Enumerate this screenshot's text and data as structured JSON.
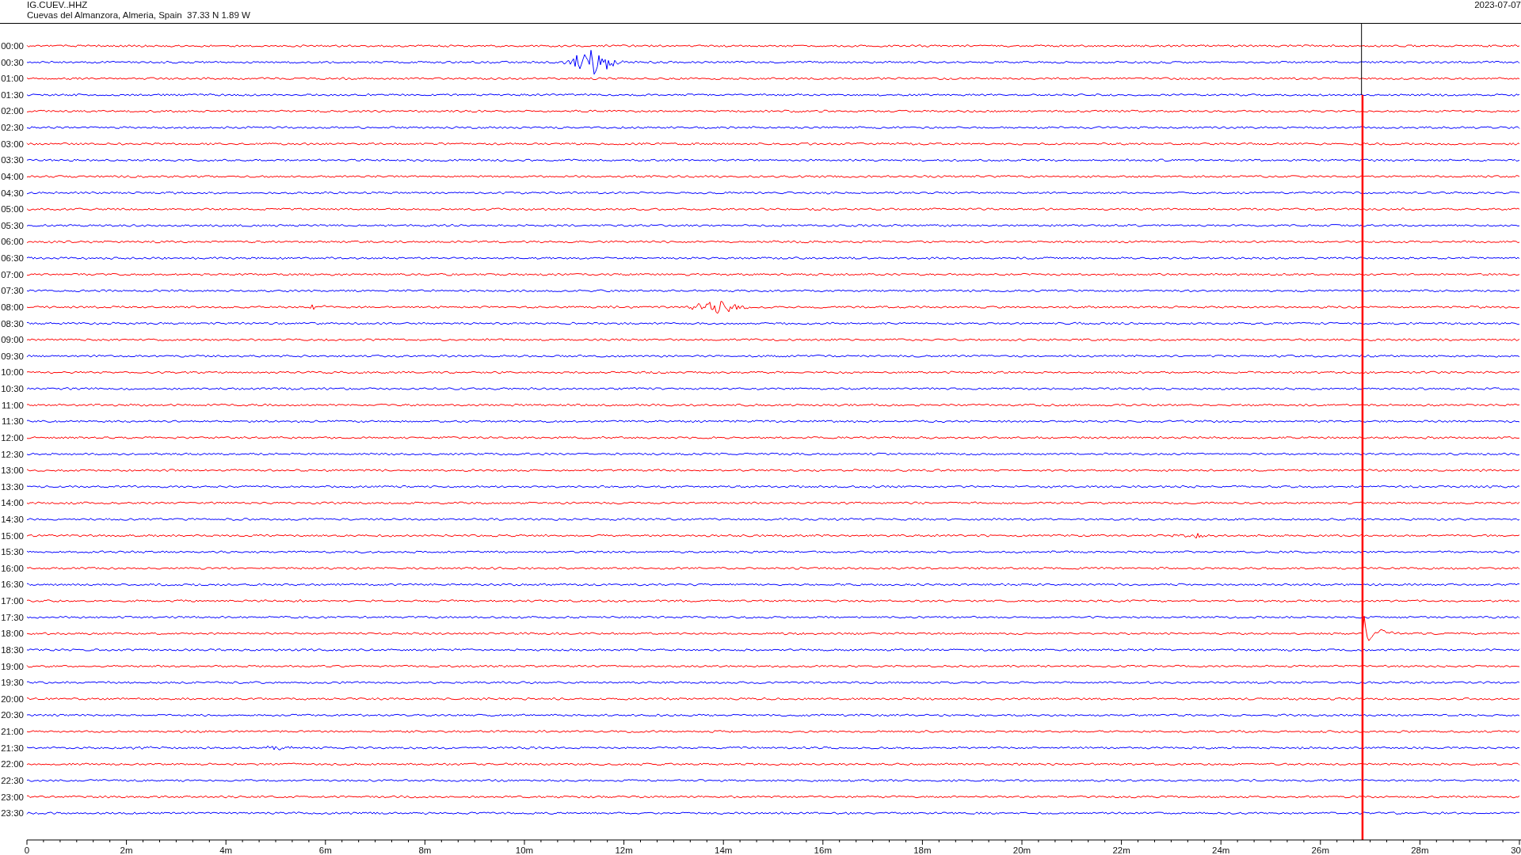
{
  "header": {
    "station": "IG.CUEV..HHZ",
    "location": "Cuevas del Almanzora, Almeria, Spain  37.33 N 1.89 W",
    "date": "2023-07-07"
  },
  "rows": [
    {
      "label": "00:00",
      "color": "#ff0000"
    },
    {
      "label": "00:30",
      "color": "#0000ff"
    },
    {
      "label": "01:00",
      "color": "#ff0000"
    },
    {
      "label": "01:30",
      "color": "#0000ff"
    },
    {
      "label": "02:00",
      "color": "#ff0000"
    },
    {
      "label": "02:30",
      "color": "#0000ff"
    },
    {
      "label": "03:00",
      "color": "#ff0000"
    },
    {
      "label": "03:30",
      "color": "#0000ff"
    },
    {
      "label": "04:00",
      "color": "#ff0000"
    },
    {
      "label": "04:30",
      "color": "#0000ff"
    },
    {
      "label": "05:00",
      "color": "#ff0000"
    },
    {
      "label": "05:30",
      "color": "#0000ff"
    },
    {
      "label": "06:00",
      "color": "#ff0000"
    },
    {
      "label": "06:30",
      "color": "#0000ff"
    },
    {
      "label": "07:00",
      "color": "#ff0000"
    },
    {
      "label": "07:30",
      "color": "#0000ff"
    },
    {
      "label": "08:00",
      "color": "#ff0000"
    },
    {
      "label": "08:30",
      "color": "#0000ff"
    },
    {
      "label": "09:00",
      "color": "#ff0000"
    },
    {
      "label": "09:30",
      "color": "#0000ff"
    },
    {
      "label": "10:00",
      "color": "#ff0000"
    },
    {
      "label": "10:30",
      "color": "#0000ff"
    },
    {
      "label": "11:00",
      "color": "#ff0000"
    },
    {
      "label": "11:30",
      "color": "#0000ff"
    },
    {
      "label": "12:00",
      "color": "#ff0000"
    },
    {
      "label": "12:30",
      "color": "#0000ff"
    },
    {
      "label": "13:00",
      "color": "#ff0000"
    },
    {
      "label": "13:30",
      "color": "#0000ff"
    },
    {
      "label": "14:00",
      "color": "#ff0000"
    },
    {
      "label": "14:30",
      "color": "#0000ff"
    },
    {
      "label": "15:00",
      "color": "#ff0000"
    },
    {
      "label": "15:30",
      "color": "#0000ff"
    },
    {
      "label": "16:00",
      "color": "#ff0000"
    },
    {
      "label": "16:30",
      "color": "#0000ff"
    },
    {
      "label": "17:00",
      "color": "#ff0000"
    },
    {
      "label": "17:30",
      "color": "#0000ff"
    },
    {
      "label": "18:00",
      "color": "#ff0000"
    },
    {
      "label": "18:30",
      "color": "#0000ff"
    },
    {
      "label": "19:00",
      "color": "#ff0000"
    },
    {
      "label": "19:30",
      "color": "#0000ff"
    },
    {
      "label": "20:00",
      "color": "#ff0000"
    },
    {
      "label": "20:30",
      "color": "#0000ff"
    },
    {
      "label": "21:00",
      "color": "#ff0000"
    },
    {
      "label": "21:30",
      "color": "#0000ff"
    },
    {
      "label": "22:00",
      "color": "#ff0000"
    },
    {
      "label": "22:30",
      "color": "#0000ff"
    },
    {
      "label": "23:00",
      "color": "#ff0000"
    },
    {
      "label": "23:30",
      "color": "#0000ff"
    }
  ],
  "axis": {
    "labels": [
      "0",
      "2m",
      "4m",
      "6m",
      "8m",
      "10m",
      "12m",
      "14m",
      "16m",
      "18m",
      "20m",
      "22m",
      "24m",
      "26m",
      "28m",
      "30"
    ]
  }
}
